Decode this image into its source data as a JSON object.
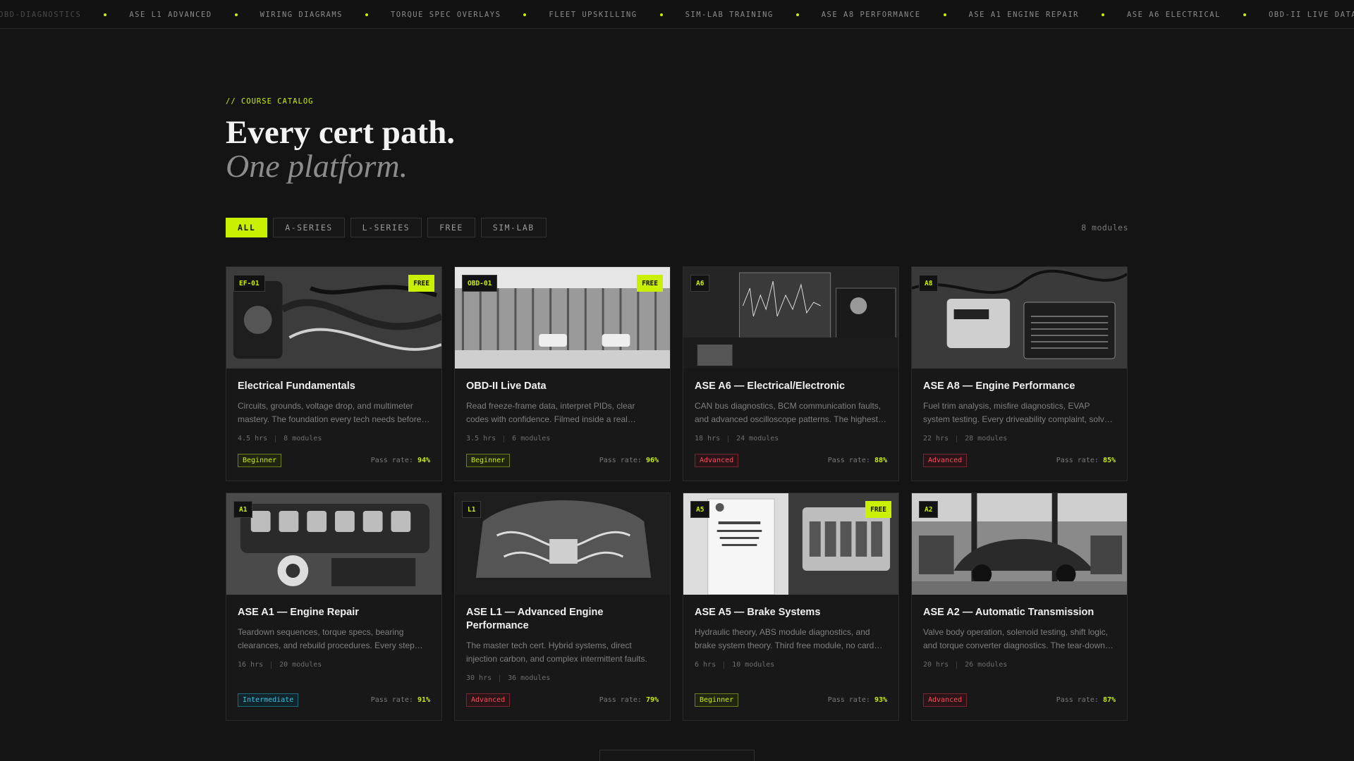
{
  "ticker": [
    "OBD-DIAGNOSTICS",
    "ASE L1 ADVANCED",
    "WIRING DIAGRAMS",
    "TORQUE SPEC OVERLAYS",
    "FLEET UPSKILLING",
    "SIM-LAB TRAINING",
    "ASE A8 PERFORMANCE",
    "ASE A1 ENGINE REPAIR",
    "ASE A6 ELECTRICAL",
    "OBD-II LIVE DATA"
  ],
  "header": {
    "eyebrow": "// COURSE CATALOG",
    "title": "Every cert path.",
    "subtitle": "One platform."
  },
  "filters": [
    {
      "label": "ALL",
      "active": true
    },
    {
      "label": "A-SERIES",
      "active": false
    },
    {
      "label": "L-SERIES",
      "active": false
    },
    {
      "label": "FREE",
      "active": false
    },
    {
      "label": "SIM-LAB",
      "active": false
    }
  ],
  "module_count": "8 modules",
  "cards": [
    {
      "code": "EF-01",
      "free": "FREE",
      "title": "Electrical Fundamentals",
      "desc": "Circuits, grounds, voltage drop, and multimeter mastery. The foundation every tech needs before…",
      "hours": "4.5 hrs",
      "modules": "8 modules",
      "level": "Beginner",
      "level_class": "beginner",
      "pass_label": "Pass rate:",
      "pass": "94%",
      "image": "multimeter-wiring-icon"
    },
    {
      "code": "OBD-01",
      "free": "FREE",
      "title": "OBD-II Live Data",
      "desc": "Read freeze-frame data, interpret PIDs, clear codes with confidence. Filmed inside a real…",
      "hours": "3.5 hrs",
      "modules": "6 modules",
      "level": "Beginner",
      "level_class": "beginner",
      "pass_label": "Pass rate:",
      "pass": "96%",
      "image": "shop-building-icon"
    },
    {
      "code": "A6",
      "free": "",
      "title": "ASE A6 — Electrical/Electronic",
      "desc": "CAN bus diagnostics, BCM communication faults, and advanced oscilloscope patterns. The highest…",
      "hours": "18 hrs",
      "modules": "24 modules",
      "level": "Advanced",
      "level_class": "advanced",
      "pass_label": "Pass rate:",
      "pass": "88%",
      "image": "oscilloscope-monitor-icon"
    },
    {
      "code": "A8",
      "free": "",
      "title": "ASE A8 — Engine Performance",
      "desc": "Fuel trim analysis, misfire diagnostics, EVAP system testing. Every driveability complaint, solv…",
      "hours": "22 hrs",
      "modules": "28 modules",
      "level": "Advanced",
      "level_class": "advanced",
      "pass_label": "Pass rate:",
      "pass": "85%",
      "image": "system-tester-icon"
    },
    {
      "code": "A1",
      "free": "",
      "title": "ASE A1 — Engine Repair",
      "desc": "Teardown sequences, torque specs, bearing clearances, and rebuild procedures. Every step…",
      "hours": "16 hrs",
      "modules": "20 modules",
      "level": "Intermediate",
      "level_class": "intermediate",
      "pass_label": "Pass rate:",
      "pass": "91%",
      "image": "engine-bay-icon"
    },
    {
      "code": "L1",
      "free": "",
      "title": "ASE L1 — Advanced Engine Performance",
      "desc": "The master tech cert. Hybrid systems, direct injection carbon, and complex intermittent faults.",
      "hours": "30 hrs",
      "modules": "36 modules",
      "level": "Advanced",
      "level_class": "advanced",
      "pass_label": "Pass rate:",
      "pass": "79%",
      "image": "v8-engine-icon"
    },
    {
      "code": "A5",
      "free": "FREE",
      "title": "ASE A5 — Brake Systems",
      "desc": "Hydraulic theory, ABS module diagnostics, and brake system theory. Third free module, no card…",
      "hours": "6 hrs",
      "modules": "10 modules",
      "level": "Beginner",
      "level_class": "beginner",
      "pass_label": "Pass rate:",
      "pass": "93%",
      "image": "certificate-battery-icon"
    },
    {
      "code": "A2",
      "free": "",
      "title": "ASE A2 — Automatic Transmission",
      "desc": "Valve body operation, solenoid testing, shift logic, and torque converter diagnostics. The tear-down…",
      "hours": "20 hrs",
      "modules": "26 modules",
      "level": "Advanced",
      "level_class": "advanced",
      "pass_label": "Pass rate:",
      "pass": "87%",
      "image": "car-on-lift-icon"
    }
  ],
  "colors": {
    "accent": "#c8f000",
    "advanced": "#ff4d5e",
    "intermediate": "#36c6e6",
    "background": "#141414"
  }
}
